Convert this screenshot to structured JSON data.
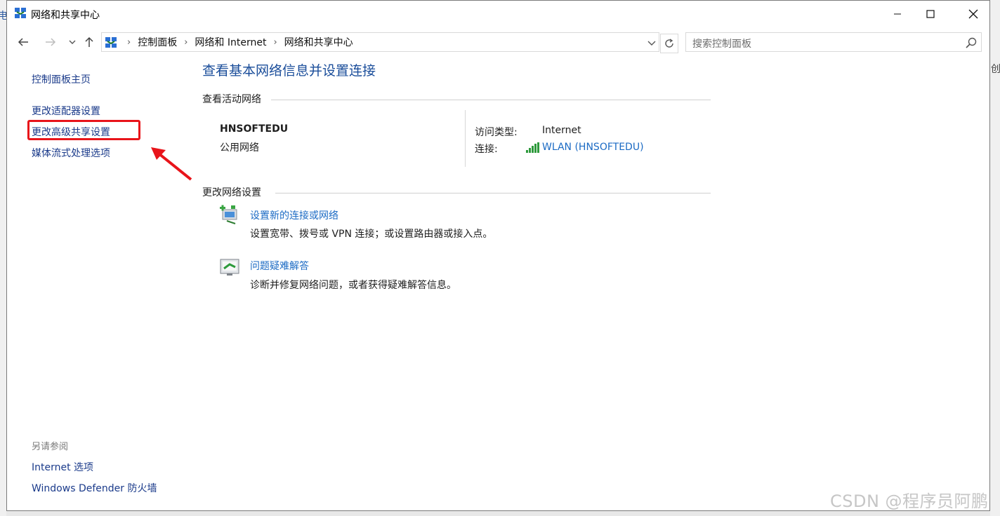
{
  "background": {
    "left_edge_char": "电",
    "right_edge_char": "创"
  },
  "window": {
    "title": "网络和共享中心",
    "controls": {
      "minimize": "minimize-icon",
      "maximize": "maximize-icon",
      "close": "close-icon"
    }
  },
  "nav": {
    "breadcrumb": [
      "控制面板",
      "网络和 Internet",
      "网络和共享中心"
    ],
    "search_placeholder": "搜索控制面板"
  },
  "sidebar": {
    "home": "控制面板主页",
    "links": [
      "更改适配器设置",
      "更改高级共享设置",
      "媒体流式处理选项"
    ],
    "see_also_heading": "另请参阅",
    "see_also": [
      "Internet 选项",
      "Windows Defender 防火墙"
    ]
  },
  "annotation": {
    "highlight_color": "#e8141a"
  },
  "main": {
    "title": "查看基本网络信息并设置连接",
    "active_section": "查看活动网络",
    "network": {
      "name": "HNSOFTEDU",
      "category": "公用网络",
      "access_label": "访问类型:",
      "access_value": "Internet",
      "connection_label": "连接:",
      "connection_value": "WLAN (HNSOFTEDU)"
    },
    "change_section": "更改网络设置",
    "tasks": [
      {
        "title": "设置新的连接或网络",
        "desc": "设置宽带、拨号或 VPN 连接；或设置路由器或接入点。"
      },
      {
        "title": "问题疑难解答",
        "desc": "诊断并修复网络问题，或者获得疑难解答信息。"
      }
    ]
  },
  "watermark": "CSDN @程序员阿鹏",
  "colors": {
    "link": "#1c6bc4",
    "title": "#1a4d9a",
    "nav_link": "#1a3a8a"
  }
}
